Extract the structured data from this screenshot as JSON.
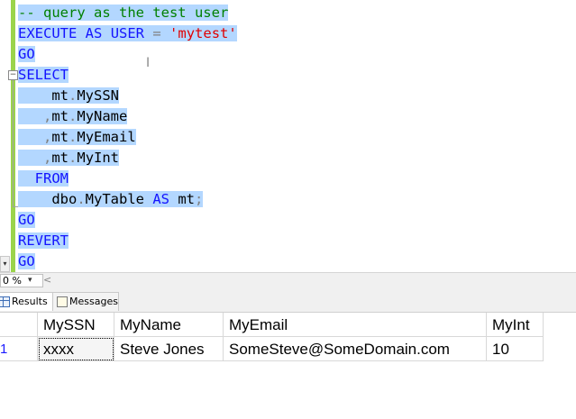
{
  "editor": {
    "lines": [
      {
        "segments": [
          {
            "t": "-- query as the test user",
            "c": "cmt"
          }
        ]
      },
      {
        "segments": [
          {
            "t": "EXECUTE",
            "c": "kw"
          },
          {
            "t": " ",
            "c": "txt"
          },
          {
            "t": "AS",
            "c": "kw"
          },
          {
            "t": " ",
            "c": "txt"
          },
          {
            "t": "USER",
            "c": "kw"
          },
          {
            "t": " ",
            "c": "txt"
          },
          {
            "t": "=",
            "c": "op"
          },
          {
            "t": " ",
            "c": "txt"
          },
          {
            "t": "'mytest'",
            "c": "str"
          }
        ]
      },
      {
        "segments": [
          {
            "t": "GO",
            "c": "kw"
          }
        ]
      },
      {
        "segments": [
          {
            "t": "SELECT",
            "c": "kw"
          }
        ]
      },
      {
        "segments": [
          {
            "t": "    mt",
            "c": "txt"
          },
          {
            "t": ".",
            "c": "op"
          },
          {
            "t": "MySSN",
            "c": "txt"
          }
        ]
      },
      {
        "segments": [
          {
            "t": "   ",
            "c": "txt"
          },
          {
            "t": ",",
            "c": "op"
          },
          {
            "t": "mt",
            "c": "txt"
          },
          {
            "t": ".",
            "c": "op"
          },
          {
            "t": "MyName",
            "c": "txt"
          }
        ]
      },
      {
        "segments": [
          {
            "t": "   ",
            "c": "txt"
          },
          {
            "t": ",",
            "c": "op"
          },
          {
            "t": "mt",
            "c": "txt"
          },
          {
            "t": ".",
            "c": "op"
          },
          {
            "t": "MyEmail",
            "c": "txt"
          }
        ]
      },
      {
        "segments": [
          {
            "t": "   ",
            "c": "txt"
          },
          {
            "t": ",",
            "c": "op"
          },
          {
            "t": "mt",
            "c": "txt"
          },
          {
            "t": ".",
            "c": "op"
          },
          {
            "t": "MyInt",
            "c": "txt"
          }
        ]
      },
      {
        "segments": [
          {
            "t": "  ",
            "c": "txt"
          },
          {
            "t": "FROM",
            "c": "kw"
          }
        ]
      },
      {
        "segments": [
          {
            "t": "    dbo",
            "c": "txt"
          },
          {
            "t": ".",
            "c": "op"
          },
          {
            "t": "MyTable ",
            "c": "txt"
          },
          {
            "t": "AS",
            "c": "kw"
          },
          {
            "t": " mt",
            "c": "txt"
          },
          {
            "t": ";",
            "c": "op"
          }
        ]
      },
      {
        "segments": [
          {
            "t": "GO",
            "c": "kw"
          }
        ]
      },
      {
        "segments": [
          {
            "t": "REVERT",
            "c": "kw"
          }
        ]
      },
      {
        "segments": [
          {
            "t": "GO",
            "c": "kw"
          }
        ]
      }
    ],
    "collapse_glyph": "⊟",
    "split_arrow_glyph": "▾"
  },
  "zoom": {
    "value": "0 %",
    "dropdown_glyph": "▾",
    "scroll_left_glyph": "<"
  },
  "tabs": {
    "results": "Results",
    "messages": "Messages"
  },
  "results": {
    "columns": [
      "MySSN",
      "MyName",
      "MyEmail",
      "MyInt"
    ],
    "rows": [
      {
        "num": "1",
        "cells": [
          "xxxx",
          "Steve Jones",
          "SomeSteve@SomeDomain.com",
          "10"
        ]
      }
    ]
  },
  "colors": {
    "selection": "#b3d7ff",
    "keyword": "#1414ff",
    "string": "#e10000",
    "comment": "#008000",
    "change_margin": "#9bd44b"
  }
}
